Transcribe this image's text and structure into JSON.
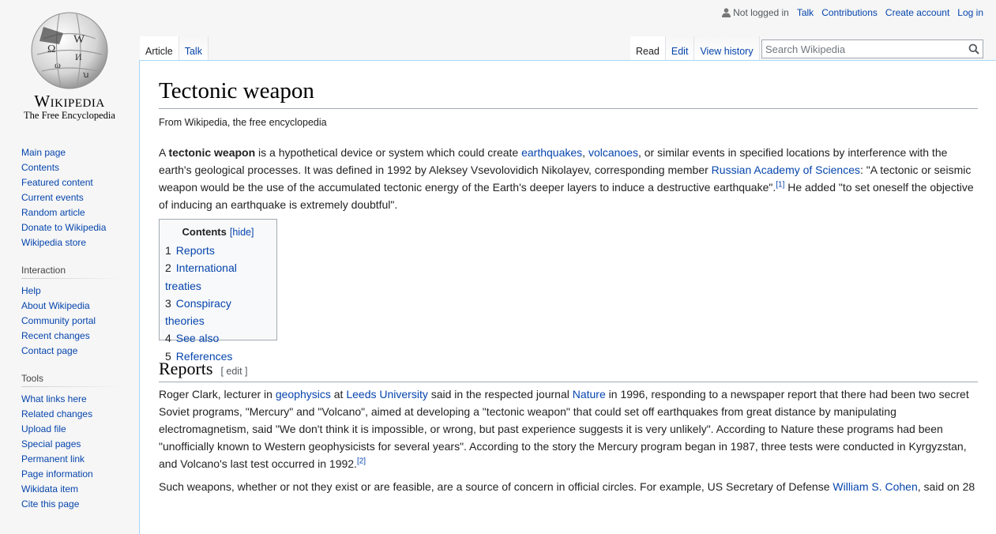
{
  "logo": {
    "wordmark": "Wikipedia",
    "tagline": "The Free Encyclopedia"
  },
  "personal": {
    "not_logged_in": "Not logged in",
    "talk": "Talk",
    "contributions": "Contributions",
    "create_account": "Create account",
    "log_in": "Log in"
  },
  "tabs": {
    "article": "Article",
    "talk": "Talk",
    "read": "Read",
    "edit": "Edit",
    "history": "View history"
  },
  "search": {
    "placeholder": "Search Wikipedia"
  },
  "sidebar": {
    "navigation": [
      "Main page",
      "Contents",
      "Featured content",
      "Current events",
      "Random article",
      "Donate to Wikipedia",
      "Wikipedia store"
    ],
    "interaction_title": "Interaction",
    "interaction": [
      "Help",
      "About Wikipedia",
      "Community portal",
      "Recent changes",
      "Contact page"
    ],
    "tools_title": "Tools",
    "tools": [
      "What links here",
      "Related changes",
      "Upload file",
      "Special pages",
      "Permanent link",
      "Page information",
      "Wikidata item",
      "Cite this page"
    ]
  },
  "article": {
    "title": "Tectonic weapon",
    "site_sub": "From Wikipedia, the free encyclopedia",
    "intro": {
      "t1": "A ",
      "bold": "tectonic weapon",
      "t2": " is a hypothetical device or system which could create ",
      "l_earthquakes": "earthquakes",
      "comma1": ", ",
      "l_volcanoes": "volcanoes",
      "t3": ", or similar events in specified locations by interference with the earth's geological processes. It was defined in 1992 by Aleksey Vsevolovidich Nikolayev, corresponding member ",
      "l_ras": "Russian Academy of Sciences",
      "t4": ": \"A tectonic or seismic weapon would be the use of the accumulated tectonic energy of the Earth's deeper layers to induce a destructive earthquake\".",
      "ref1": "[1]",
      "t5": " He added \"to set oneself the objective of inducing an earthquake is extremely doubtful\"."
    },
    "toc": {
      "title": "Contents",
      "toggle": "[hide]",
      "items": [
        {
          "num": "1",
          "label": "Reports"
        },
        {
          "num": "2",
          "label": "International treaties"
        },
        {
          "num": "3",
          "label": "Conspiracy theories"
        },
        {
          "num": "4",
          "label": "See also"
        },
        {
          "num": "5",
          "label": "References"
        }
      ]
    },
    "reports": {
      "heading": "Reports",
      "edit": "[ edit ]",
      "p1": {
        "t1": "Roger Clark, lecturer in ",
        "l_geophysics": "geophysics",
        "t2": " at ",
        "l_leeds": "Leeds University",
        "t3": " said in the respected journal ",
        "l_nature": "Nature",
        "t4": " in 1996, responding to a newspaper report that there had been two secret Soviet programs, \"Mercury\" and \"Volcano\", aimed at developing a \"tectonic weapon\" that could set off earthquakes from great distance by manipulating electromagnetism, said \"We don't think it is impossible, or wrong, but past experience suggests it is very unlikely\". According to Nature these programs had been \"unofficially known to Western geophysicists for several years\". According to the story the Mercury program began in 1987, three tests were conducted in Kyrgyzstan, and Volcano's last test occurred in 1992.",
        "ref2": "[2]"
      },
      "p2": {
        "t1": "Such weapons, whether or not they exist or are feasible, are a source of concern in official circles. For example, US Secretary of Defense ",
        "l_cohen": "William S. Cohen",
        "t2": ", said on 28"
      }
    }
  }
}
